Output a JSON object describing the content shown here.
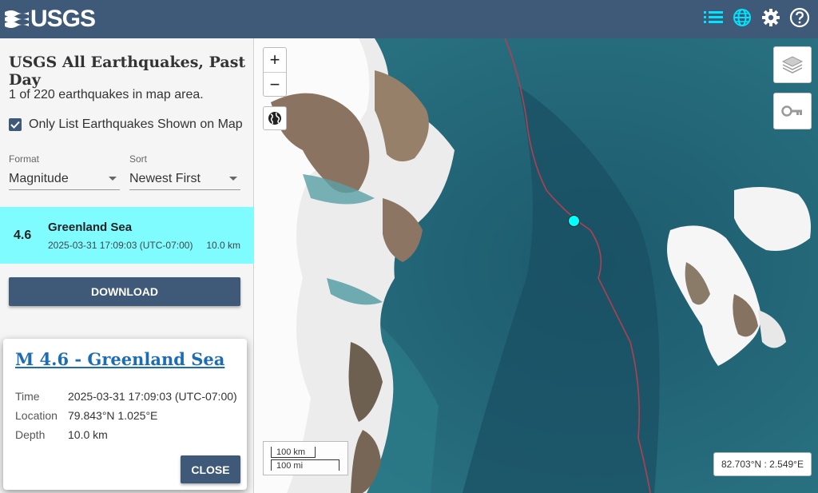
{
  "header": {
    "logo_text": "USGS",
    "icons": [
      "list-icon",
      "globe-icon",
      "gear-icon",
      "help-icon"
    ],
    "accent": "#3e5a78"
  },
  "sidebar": {
    "title": "USGS All Earthquakes, Past Day",
    "count": "1 of 220 earthquakes in map area.",
    "only_list_label": "Only List Earthquakes Shown on Map",
    "only_list_checked": true,
    "format": {
      "label": "Format",
      "value": "Magnitude"
    },
    "sort": {
      "label": "Sort",
      "value": "Newest First"
    },
    "earthquakes": [
      {
        "mag": "4.6",
        "place": "Greenland Sea",
        "time": "2025-03-31 17:09:03 (UTC-07:00)",
        "depth": "10.0 km",
        "highlight_color": "#7ffcff"
      }
    ],
    "download_label": "DOWNLOAD"
  },
  "map": {
    "zoom_in": "+",
    "zoom_out": "−",
    "scale_km": "100 km",
    "scale_mi": "100 mi",
    "coords": "82.703°N : 2.549°E",
    "marker_color": "#00ffff"
  },
  "popup": {
    "title": "M 4.6 - Greenland Sea",
    "time_label": "Time",
    "time_value": "2025-03-31 17:09:03 (UTC-07:00)",
    "location_label": "Location",
    "location_value": "79.843°N 1.025°E",
    "depth_label": "Depth",
    "depth_value": "10.0 km",
    "close_label": "CLOSE"
  }
}
